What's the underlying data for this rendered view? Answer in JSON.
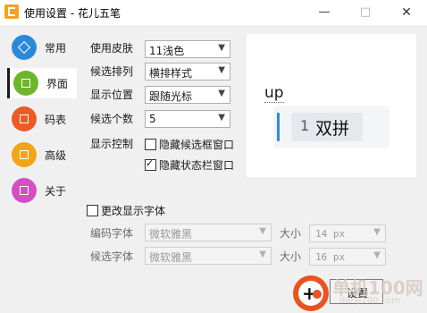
{
  "window": {
    "title": "使用设置 - 花儿五笔",
    "minimize": "—",
    "maximize": "□",
    "close": "✕"
  },
  "nav": {
    "items": [
      {
        "label": "常用",
        "icon": "square-diamond-icon",
        "color": "#2b8ad8"
      },
      {
        "label": "界面",
        "icon": "layout-icon",
        "color": "#6fb52c"
      },
      {
        "label": "码表",
        "icon": "crop-icon",
        "color": "#ee5a24"
      },
      {
        "label": "高级",
        "icon": "grid-icon",
        "color": "#f4a418"
      },
      {
        "label": "关于",
        "icon": "info-card-icon",
        "color": "#d44fc4"
      }
    ],
    "active_index": 1
  },
  "settings": {
    "skin": {
      "label": "使用皮肤",
      "value": "11浅色"
    },
    "layout": {
      "label": "候选排列",
      "value": "横排样式"
    },
    "position": {
      "label": "显示位置",
      "value": "跟随光标"
    },
    "count": {
      "label": "候选个数",
      "value": "5"
    },
    "display_control": {
      "label": "显示控制"
    },
    "hide_candidate_box": {
      "label": "隐藏候选框窗口",
      "checked": false
    },
    "hide_status_bar": {
      "label": "隐藏状态栏窗口",
      "checked": true
    }
  },
  "preview": {
    "code": "up",
    "candidate_number": "1",
    "candidate_text": "双拼"
  },
  "fonts": {
    "change_font": {
      "label": "更改显示字体",
      "checked": false
    },
    "code_font": {
      "label": "编码字体",
      "value": "微软雅黑",
      "size_label": "大小",
      "size_value": "14 px"
    },
    "candidate_font": {
      "label": "候选字体",
      "value": "微软雅黑",
      "size_label": "大小",
      "size_value": "16 px"
    }
  },
  "buttons": {
    "reset": "设置"
  },
  "watermark": {
    "text": "单机100网",
    "sub": "danji100.com"
  }
}
